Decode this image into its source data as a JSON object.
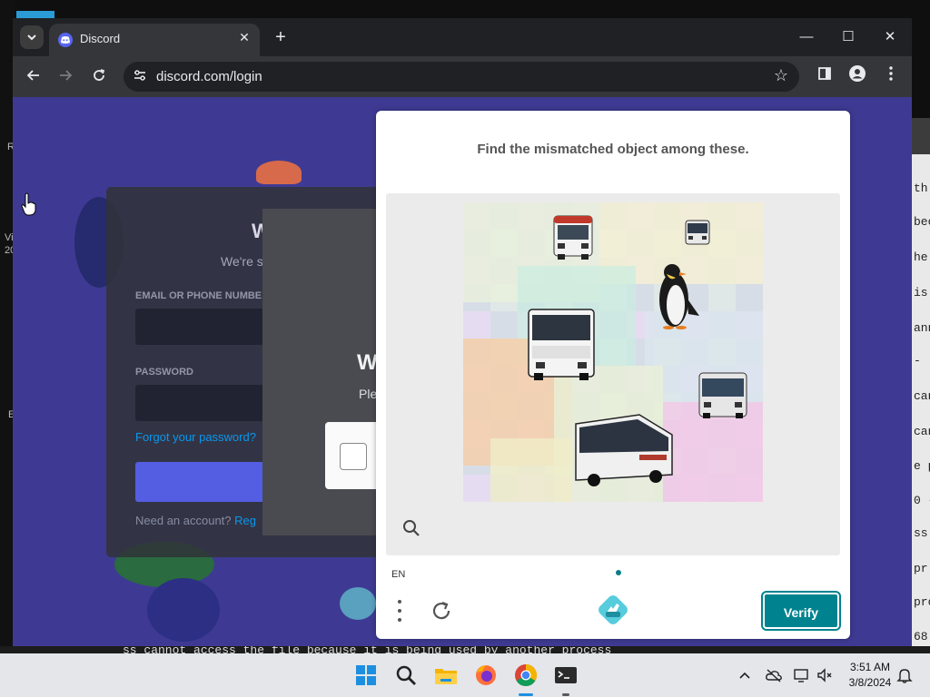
{
  "browser": {
    "tab_title": "Discord",
    "url": "discord.com/login",
    "tab_close_glyph": "✕",
    "new_tab_glyph": "+",
    "window_minimize": "—",
    "window_maximize": "☐",
    "window_close": "✕"
  },
  "desktop": {
    "left_letters": [
      "R",
      "Vi",
      "20",
      "E"
    ],
    "right_terminal_lines": [
      " th",
      "bec",
      "he ",
      "is ",
      "ann",
      " - ",
      "can",
      "can",
      "e p",
      "0 -",
      "ss ",
      " pr",
      "pro",
      "68 "
    ],
    "bottom_terminal_text": "ss cannot access the file because it is being used by another process"
  },
  "login_background": {
    "welcome": "W",
    "subtitle": "We're s",
    "email_label": "EMAIL OR PHONE NUMBE",
    "password_label": "PASSWORD",
    "forgot": "Forgot your password?",
    "need_account": "Need an account?",
    "register": "Reg",
    "modal_title": "W",
    "modal_sub": "Ple"
  },
  "captcha": {
    "prompt": "Find the mismatched object among these.",
    "language": "EN",
    "verify_label": "Verify",
    "objects": [
      "bus-icon",
      "bus-icon",
      "bus-icon",
      "bus-icon",
      "bus-icon",
      "penguin-icon"
    ]
  },
  "taskbar": {
    "time": "3:51 AM",
    "date": "3/8/2024",
    "apps": [
      "windows-start-icon",
      "search-icon",
      "file-explorer-icon",
      "firefox-icon",
      "chrome-icon",
      "terminal-icon"
    ]
  },
  "colors": {
    "discord_bg": "#3e3a93",
    "captcha_verify": "#00838f",
    "chrome_dark": "#202124"
  }
}
